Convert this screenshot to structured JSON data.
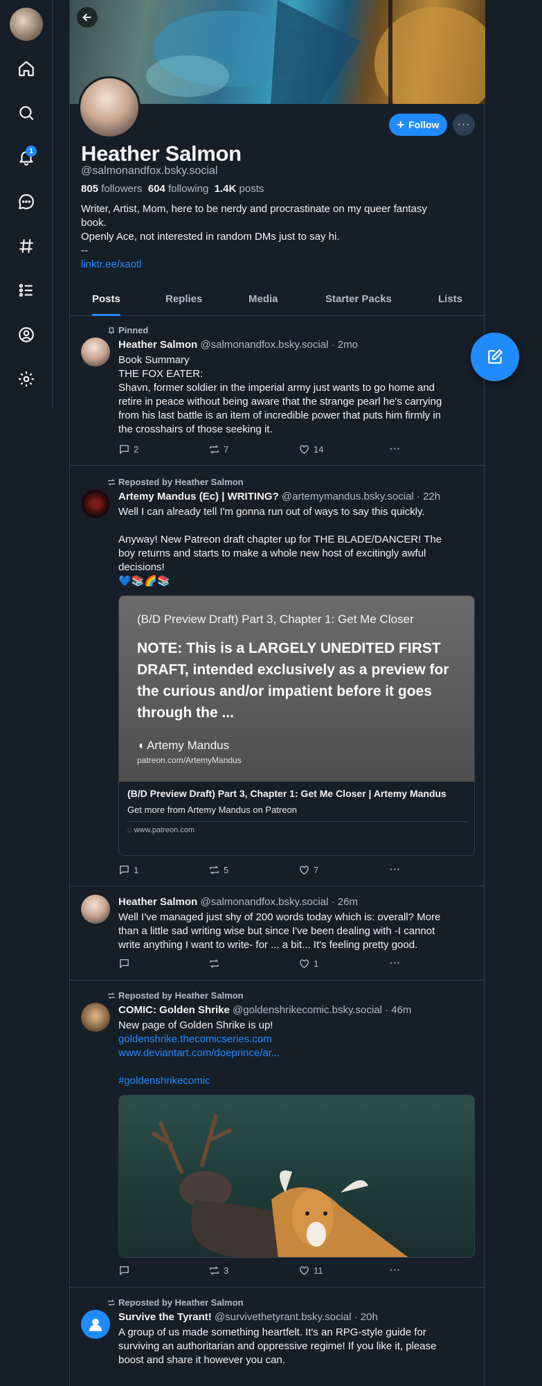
{
  "nav": {
    "notification_count": "1"
  },
  "profile": {
    "name": "Heather Salmon",
    "handle": "@salmonandfox.bsky.social",
    "followers_count": "805",
    "followers_label": "followers",
    "following_count": "604",
    "following_label": "following",
    "posts_count": "1.4K",
    "posts_label": "posts",
    "bio_lines": [
      "Writer, Artist, Mom, here to be nerdy and procrastinate on my queer fantasy",
      "book.",
      "Openly Ace, not interested in random DMs just to say hi.",
      "--"
    ],
    "link": "linktr.ee/xaotl",
    "follow_label": "Follow",
    "more_label": "···"
  },
  "tabs": [
    "Posts",
    "Replies",
    "Media",
    "Starter Packs",
    "Lists"
  ],
  "posts": [
    {
      "meta": "Pinned",
      "author": "Heather Salmon",
      "handle": "@salmonandfox.bsky.social",
      "time": "· 2mo",
      "lines": [
        "Book Summary",
        "THE FOX EATER:",
        "Shavn, former soldier in the imperial army just wants to go home and",
        "retire in peace without being aware that the strange pearl he's carrying",
        "from his last battle is an item of incredible power that puts him firmly in",
        "the crosshairs of those seeking it."
      ],
      "replies": "2",
      "reposts": "7",
      "likes": "14"
    },
    {
      "meta": "Reposted by Heather Salmon",
      "author": "Artemy Mandus (Ec) | WRITING?",
      "handle": "@artemymandus.bsky.social",
      "time": "· 22h",
      "lines": [
        "Well I can already tell I'm gonna run out of ways to say this quickly.",
        "",
        "Anyway! New Patreon draft chapter up for THE BLADE/DANCER! The",
        "boy returns and starts to make a whole new host of excitingly awful",
        "decisions!",
        "💙📚🌈📚"
      ],
      "embed": {
        "img_title": "(B/D Preview Draft) Part 3, Chapter 1: Get Me Closer",
        "img_note": "NOTE: This is a LARGELY UNEDITED FIRST DRAFT, intended exclusively as a preview for the curious and/or impatient before it goes through the ...",
        "img_author": "Artemy Mandus",
        "img_url": "patreon.com/ArtemyMandus",
        "title": "(B/D Preview Draft) Part 3, Chapter 1: Get Me Closer | Artemy Mandus",
        "desc": "Get more from Artemy Mandus on Patreon",
        "domain": "www.patreon.com"
      },
      "replies": "1",
      "reposts": "5",
      "likes": "7"
    },
    {
      "author": "Heather Salmon",
      "handle": "@salmonandfox.bsky.social",
      "time": "· 26m",
      "lines": [
        "Well I've managed just shy of 200 words today which is: overall? More",
        "than a little sad writing wise but since I've been dealing with -I cannot",
        "write anything I want to write- for ... a bit... It's feeling pretty good."
      ],
      "replies": "",
      "reposts": "",
      "likes": "1"
    },
    {
      "meta": "Reposted by Heather Salmon",
      "author": "COMIC: Golden Shrike",
      "handle": "@goldenshrikecomic.bsky.social",
      "time": "· 46m",
      "lines": [
        "New page of Golden Shrike is up!"
      ],
      "links": [
        "goldenshrike.thecomicseries.com",
        "www.deviantart.com/doeprince/ar...",
        "",
        "#goldenshrikecomic"
      ],
      "replies": "",
      "reposts": "3",
      "likes": "11"
    },
    {
      "meta": "Reposted by Heather Salmon",
      "author": "Survive the Tyrant!",
      "handle": "@survivethetyrant.bsky.social",
      "time": "· 20h",
      "lines": [
        "A group of us made something heartfelt. It's an RPG-style guide for",
        "surviving an authoritarian and oppressive regime! If you like it, please",
        "boost and share it however you can."
      ]
    }
  ]
}
